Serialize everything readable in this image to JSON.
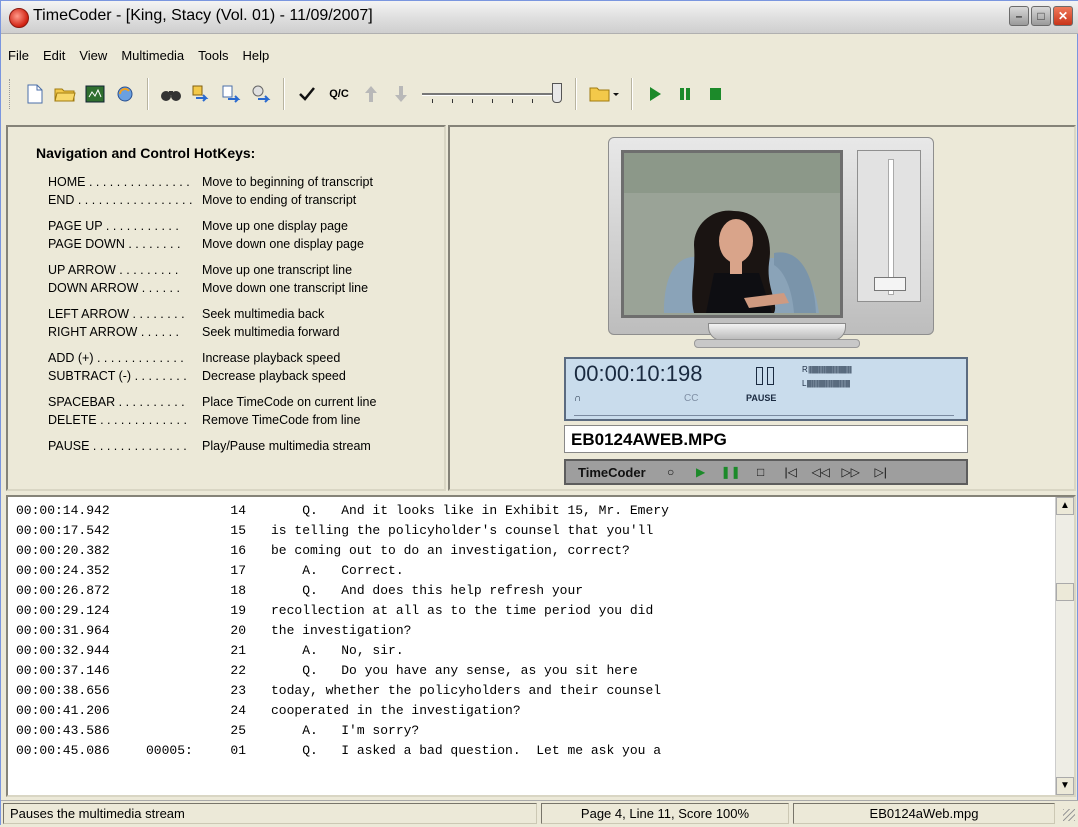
{
  "window": {
    "title": "TimeCoder - [King, Stacy (Vol. 01) - 11/09/2007]"
  },
  "menu": [
    "File",
    "Edit",
    "View",
    "Multimedia",
    "Tools",
    "Help"
  ],
  "toolbar": {
    "qc_label": "Q/C",
    "icons": [
      "new-document-icon",
      "open-folder-icon",
      "media-icon",
      "sync-icon",
      "find-binoculars-icon",
      "bookmark-arrow-icon",
      "export-arrow-icon",
      "import-arrow-icon",
      "checkmark-icon",
      "up-arrow-icon",
      "down-arrow-icon",
      "folder-dropdown-icon",
      "play-icon",
      "pause-icon",
      "stop-icon"
    ]
  },
  "hotkeys": {
    "title": "Navigation and Control HotKeys:",
    "items": [
      {
        "key": "HOME . . . . . . . . . . . . . . .",
        "desc": "Move to beginning of transcript"
      },
      {
        "key": "END . . . . . . . . . . . . . . . . .",
        "desc": "Move to ending of transcript"
      },
      {
        "key": "PAGE UP . . . . . . . . . . .",
        "desc": "Move up one display page"
      },
      {
        "key": "PAGE DOWN . . . . . . . .",
        "desc": "Move down one display page"
      },
      {
        "key": "UP ARROW . . . . . . . . .",
        "desc": "Move up one transcript line"
      },
      {
        "key": "DOWN ARROW . . . . . .",
        "desc": "Move down one transcript line"
      },
      {
        "key": "LEFT ARROW . . . . . . . .",
        "desc": "Seek multimedia back"
      },
      {
        "key": "RIGHT ARROW . . . . . .",
        "desc": "Seek multimedia forward"
      },
      {
        "key": "ADD (+) . . . . . . . . . . . . .",
        "desc": "Increase playback speed"
      },
      {
        "key": "SUBTRACT (-) . . . . . . . .",
        "desc": "Decrease playback speed"
      },
      {
        "key": "SPACEBAR . . . . . . . . . .",
        "desc": "Place TimeCode on current line"
      },
      {
        "key": "DELETE . . . . . . . . . . . . .",
        "desc": "Remove TimeCode from line"
      },
      {
        "key": "PAUSE . . . . . . . . . . . . . .",
        "desc": "Play/Pause multimedia stream"
      }
    ]
  },
  "player": {
    "time": "00:00:10:198",
    "state": "PAUSE",
    "channel_r": "R",
    "channel_l": "L",
    "cc_label": "CC",
    "filename": "EB0124AWEB.MPG",
    "brand": "TimeCoder",
    "controls": [
      "record-icon",
      "play-icon",
      "pause-icon",
      "stop-icon",
      "skip-back-icon",
      "rewind-icon",
      "fast-forward-icon",
      "skip-forward-icon"
    ]
  },
  "transcript": [
    {
      "time": "00:00:14.942",
      "page": "",
      "line": "14",
      "text": "    Q.   And it looks like in Exhibit 15, Mr. Emery"
    },
    {
      "time": "00:00:17.542",
      "page": "",
      "line": "15",
      "text": "is telling the policyholder's counsel that you'll"
    },
    {
      "time": "00:00:20.382",
      "page": "",
      "line": "16",
      "text": "be coming out to do an investigation, correct?"
    },
    {
      "time": "00:00:24.352",
      "page": "",
      "line": "17",
      "text": "    A.   Correct."
    },
    {
      "time": "00:00:26.872",
      "page": "",
      "line": "18",
      "text": "    Q.   And does this help refresh your"
    },
    {
      "time": "00:00:29.124",
      "page": "",
      "line": "19",
      "text": "recollection at all as to the time period you did"
    },
    {
      "time": "00:00:31.964",
      "page": "",
      "line": "20",
      "text": "the investigation?"
    },
    {
      "time": "00:00:32.944",
      "page": "",
      "line": "21",
      "text": "    A.   No, sir."
    },
    {
      "time": "00:00:37.146",
      "page": "",
      "line": "22",
      "text": "    Q.   Do you have any sense, as you sit here"
    },
    {
      "time": "00:00:38.656",
      "page": "",
      "line": "23",
      "text": "today, whether the policyholders and their counsel"
    },
    {
      "time": "00:00:41.206",
      "page": "",
      "line": "24",
      "text": "cooperated in the investigation?"
    },
    {
      "time": "00:00:43.586",
      "page": "",
      "line": "25",
      "text": "    A.   I'm sorry?"
    },
    {
      "time": "00:00:45.086",
      "page": "00005:",
      "line": "01",
      "text": "    Q.   I asked a bad question.  Let me ask you a"
    }
  ],
  "status": {
    "message": "Pauses the multimedia stream",
    "position": "Page 4, Line 11, Score 100%",
    "file": "EB0124aWeb.mpg"
  },
  "colors": {
    "lcd_bg": "#c9dcec",
    "play_green": "#1c8a2a",
    "close_red": "#c8341a"
  }
}
